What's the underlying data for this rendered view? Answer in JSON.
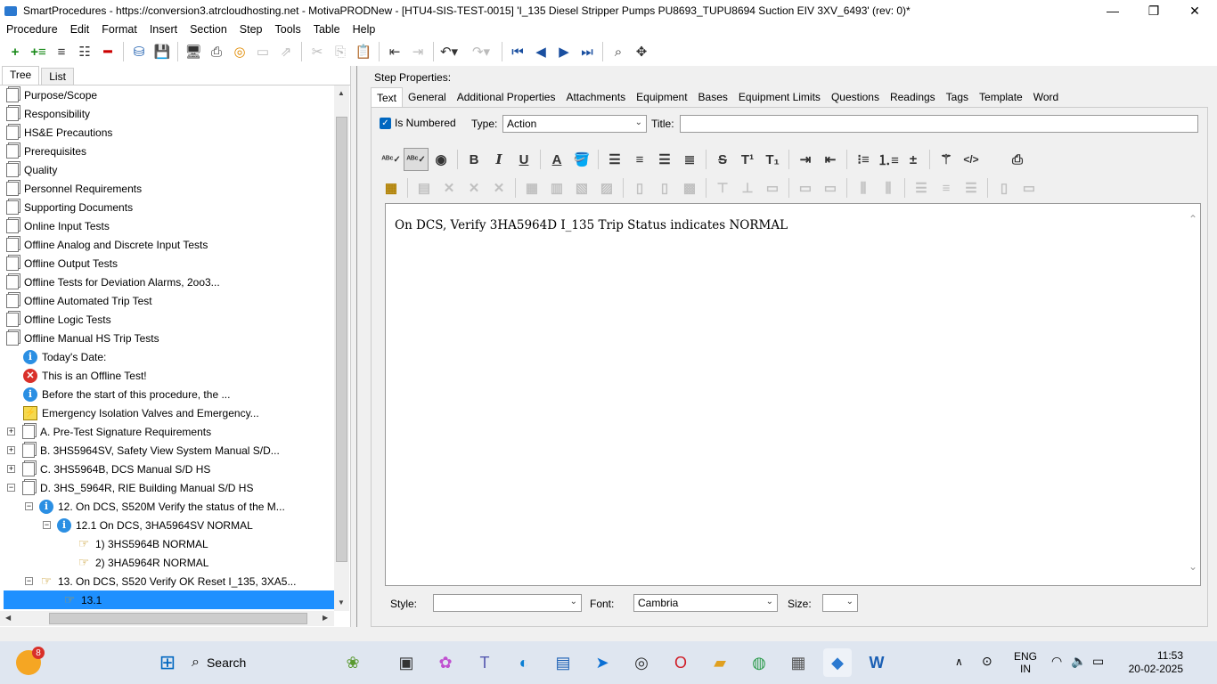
{
  "window": {
    "title": "SmartProcedures - https://conversion3.atrcloudhosting.net - MotivaPRODNew - [HTU4-SIS-TEST-0015] 'I_135 Diesel Stripper Pumps PU8693_TUPU8694 Suction EIV 3XV_6493' (rev: 0)*",
    "minimize": "—",
    "maximize": "❐",
    "close": "✕"
  },
  "menu": [
    "Procedure",
    "Edit",
    "Format",
    "Insert",
    "Section",
    "Step",
    "Tools",
    "Table",
    "Help"
  ],
  "left_tabs": [
    "Tree",
    "List"
  ],
  "tree": [
    {
      "label": "Purpose/Scope",
      "icon": "doc",
      "indent": 0,
      "exp": ""
    },
    {
      "label": "Responsibility",
      "icon": "doc",
      "indent": 0,
      "exp": ""
    },
    {
      "label": "HS&E Precautions",
      "icon": "doc",
      "indent": 0,
      "exp": ""
    },
    {
      "label": "Prerequisites",
      "icon": "doc",
      "indent": 0,
      "exp": ""
    },
    {
      "label": "Quality",
      "icon": "doc",
      "indent": 0,
      "exp": ""
    },
    {
      "label": "Personnel Requirements",
      "icon": "doc",
      "indent": 0,
      "exp": ""
    },
    {
      "label": "Supporting Documents",
      "icon": "doc",
      "indent": 0,
      "exp": ""
    },
    {
      "label": "Online Input Tests",
      "icon": "doc",
      "indent": 0,
      "exp": ""
    },
    {
      "label": "Offline Analog and Discrete Input Tests",
      "icon": "doc",
      "indent": 0,
      "exp": ""
    },
    {
      "label": "Offline Output Tests",
      "icon": "doc",
      "indent": 0,
      "exp": ""
    },
    {
      "label": "Offline Tests for Deviation Alarms, 2oo3...",
      "icon": "doc",
      "indent": 0,
      "exp": ""
    },
    {
      "label": "Offline Automated Trip Test",
      "icon": "doc",
      "indent": 0,
      "exp": ""
    },
    {
      "label": "Offline Logic Tests",
      "icon": "doc",
      "indent": 0,
      "exp": ""
    },
    {
      "label": "Offline Manual HS Trip Tests",
      "icon": "doc",
      "indent": 0,
      "exp": ""
    },
    {
      "label": "Today's Date:",
      "icon": "info",
      "indent": 1,
      "exp": ""
    },
    {
      "label": "This is an Offline Test!",
      "icon": "err",
      "indent": 1,
      "exp": ""
    },
    {
      "label": "Before the start of this procedure, the ...",
      "icon": "info",
      "indent": 1,
      "exp": ""
    },
    {
      "label": "Emergency Isolation Valves and Emergency...",
      "icon": "warn",
      "indent": 1,
      "exp": ""
    },
    {
      "label": "A. Pre-Test Signature Requirements",
      "icon": "doc",
      "indent": 1,
      "exp": "+"
    },
    {
      "label": "B. 3HS5964SV, Safety View System Manual S/D...",
      "icon": "doc",
      "indent": 1,
      "exp": "+"
    },
    {
      "label": "C. 3HS5964B, DCS Manual S/D HS",
      "icon": "doc",
      "indent": 1,
      "exp": "+"
    },
    {
      "label": "D. 3HS_5964R, RIE Building Manual S/D HS",
      "icon": "doc",
      "indent": 1,
      "exp": "−"
    },
    {
      "label": "12. On DCS, S520M Verify the status of the M...",
      "icon": "info",
      "indent": 2,
      "exp": "−"
    },
    {
      "label": "12.1 On DCS, 3HA5964SV NORMAL",
      "icon": "info",
      "indent": 3,
      "exp": "−"
    },
    {
      "label": "1) 3HS5964B NORMAL",
      "icon": "hand",
      "indent": 4,
      "exp": ""
    },
    {
      "label": "2) 3HA5964R NORMAL",
      "icon": "hand",
      "indent": 4,
      "exp": ""
    },
    {
      "label": "13. On DCS, S520 Verify OK Reset I_135, 3XA5...",
      "icon": "hand",
      "indent": 2,
      "exp": "−"
    },
    {
      "label": "13.1",
      "icon": "hand",
      "indent": 3,
      "exp": "",
      "selected": true
    }
  ],
  "step_properties": {
    "label": "Step Properties:",
    "tabs": [
      "Text",
      "General",
      "Additional Properties",
      "Attachments",
      "Equipment",
      "Bases",
      "Equipment Limits",
      "Questions",
      "Readings",
      "Tags",
      "Template",
      "Word"
    ],
    "is_numbered_label": "Is Numbered",
    "type_label": "Type:",
    "type_value": "Action",
    "title_label": "Title:",
    "title_value": "",
    "editor_text": "On DCS, Verify 3HA5964D I_135 Trip Status     indicates NORMAL",
    "style_label": "Style:",
    "style_value": "",
    "font_label": "Font:",
    "font_value": "Cambria",
    "size_label": "Size:",
    "size_value": ""
  },
  "taskbar": {
    "search_label": "Search",
    "notification_count": "8",
    "lang_line1": "ENG",
    "lang_line2": "IN",
    "time": "11:53",
    "date": "20-02-2025"
  }
}
